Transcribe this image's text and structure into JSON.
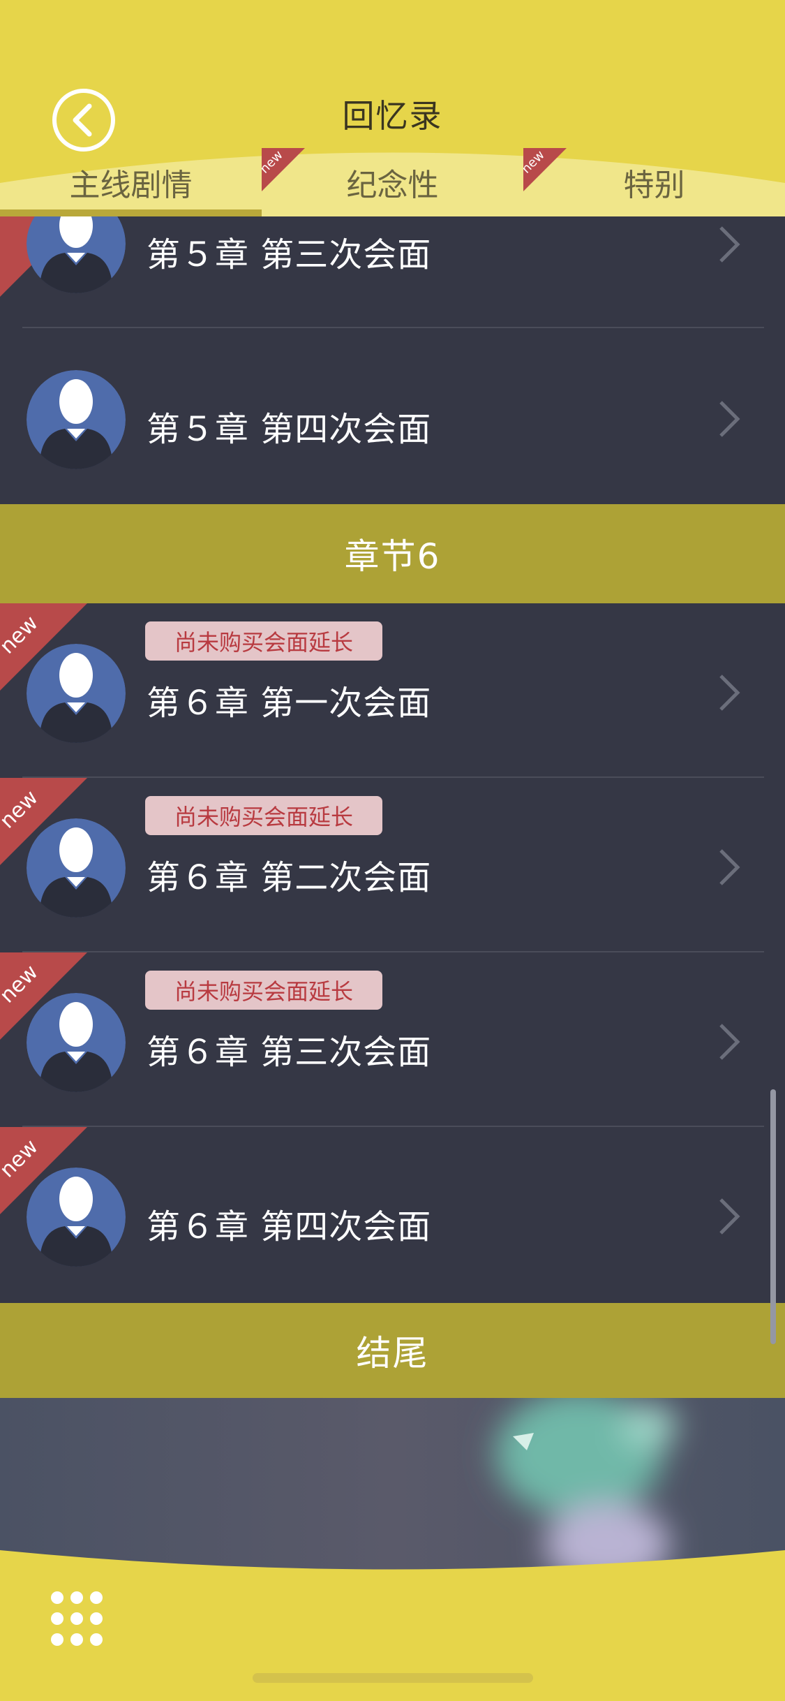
{
  "header": {
    "title": "回忆录",
    "back_icon": "chevron-left-icon",
    "tabs": [
      {
        "label": "主线剧情",
        "active": true,
        "badge": ""
      },
      {
        "label": "纪念性",
        "active": false,
        "badge": "new"
      },
      {
        "label": "特别",
        "active": false,
        "badge": "new"
      }
    ]
  },
  "rows": [
    {
      "title": "第５章 第三次会面",
      "tag": "",
      "badge": "new",
      "avatar": "user-silhouette-icon"
    },
    {
      "title": "第５章 第四次会面",
      "tag": "",
      "badge": "",
      "avatar": "user-silhouette-icon"
    },
    {
      "title": "第６章 第一次会面",
      "tag": "尚未购买会面延长",
      "badge": "new",
      "avatar": "user-silhouette-icon"
    },
    {
      "title": "第６章 第二次会面",
      "tag": "尚未购买会面延长",
      "badge": "new",
      "avatar": "user-silhouette-icon"
    },
    {
      "title": "第６章 第三次会面",
      "tag": "尚未购买会面延长",
      "badge": "new",
      "avatar": "user-silhouette-icon"
    },
    {
      "title": "第６章 第四次会面",
      "tag": "",
      "badge": "new",
      "avatar": "user-silhouette-icon"
    }
  ],
  "sections": [
    {
      "label": "章节6"
    },
    {
      "label": "结尾"
    }
  ],
  "bottom": {
    "menu_icon": "grid-menu-icon"
  },
  "colors": {
    "header_yellow": "#e6d54a",
    "tab_pale": "#f0e68a",
    "section_olive": "#ada236",
    "row_bg": "#353745",
    "avatar_blue": "#4f6cab",
    "badge_red": "#b84a4a",
    "tag_bg": "#e4c5c8",
    "tag_text": "#b83a40"
  }
}
